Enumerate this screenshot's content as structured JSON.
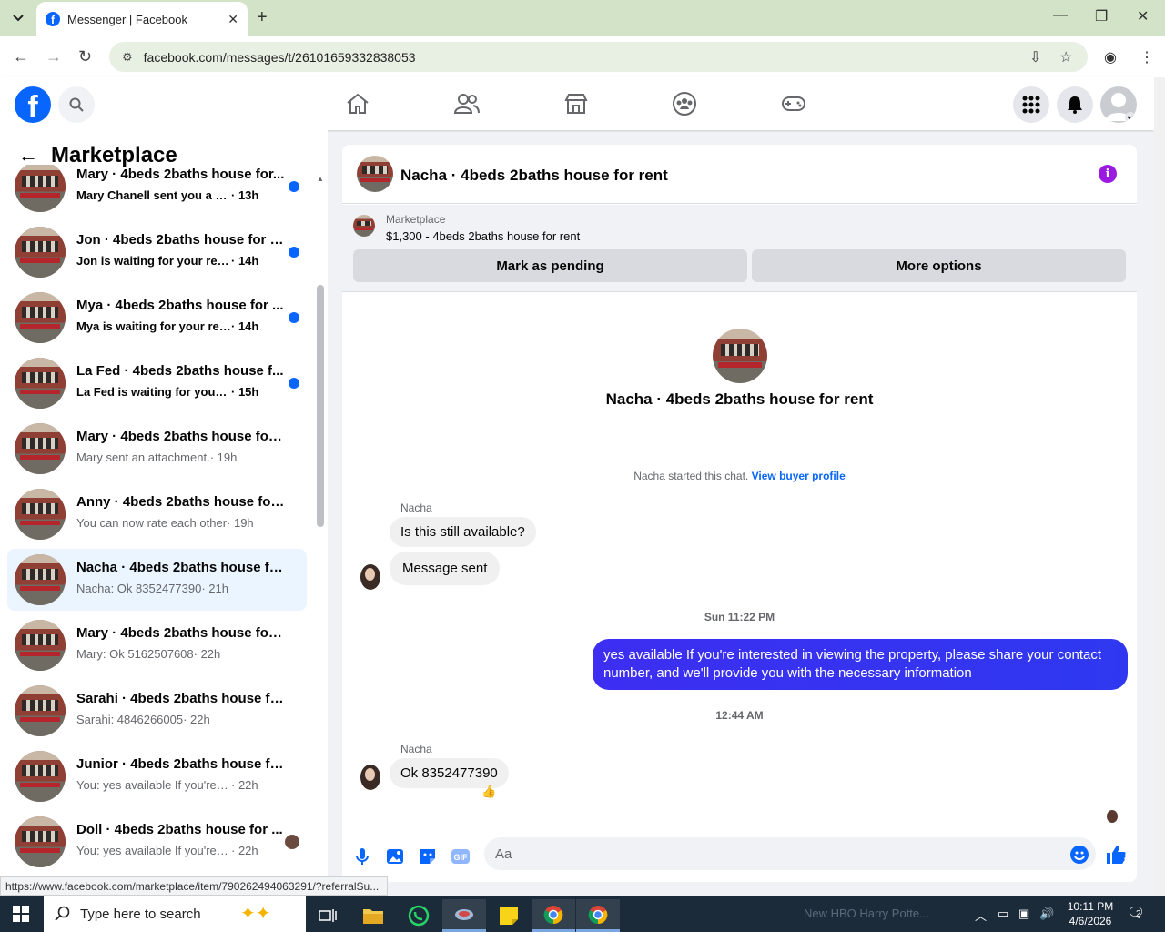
{
  "browser": {
    "tab_title": "Messenger | Facebook",
    "url": "facebook.com/messages/t/26101659332838053",
    "status_url": "https://www.facebook.com/marketplace/item/790262494063291/?referralSu..."
  },
  "sidebar": {
    "title": "Marketplace",
    "conversations": [
      {
        "title": "Mary · 4beds 2baths house for...",
        "text": "Mary Chanell sent you a messa...",
        "time": "· 13h",
        "unread": true
      },
      {
        "title": "Jon · 4beds 2baths house for r...",
        "text": "Jon is waiting for your response.",
        "time": "· 14h",
        "unread": true
      },
      {
        "title": "Mya · 4beds 2baths house for ...",
        "text": "Mya is waiting for your respon...",
        "time": "· 14h",
        "unread": true
      },
      {
        "title": "La Fed · 4beds 2baths house f...",
        "text": "La Fed is waiting for your resp...",
        "time": "· 15h",
        "unread": true
      },
      {
        "title": "Mary · 4beds 2baths house for r...",
        "text": "Mary sent an attachment.",
        "time": "· 19h",
        "unread": false
      },
      {
        "title": "Anny · 4beds 2baths house for r...",
        "text": "You can now rate each other",
        "time": "· 19h",
        "unread": false
      },
      {
        "title": "Nacha · 4beds 2baths house for ...",
        "text": "Nacha: Ok 8352477390",
        "time": "· 21h",
        "unread": false
      },
      {
        "title": "Mary · 4beds 2baths house for r...",
        "text": "Mary: Ok 5162507608",
        "time": "· 22h",
        "unread": false
      },
      {
        "title": "Sarahi · 4beds 2baths house for ...",
        "text": "Sarahi: 4846266005",
        "time": "· 22h",
        "unread": false
      },
      {
        "title": "Junior · 4beds 2baths house for ...",
        "text": "You: yes available If you're interest...",
        "time": "· 22h",
        "unread": false
      },
      {
        "title": "Doll · 4beds 2baths house for ...",
        "text": "You: yes available If you're inter...",
        "time": "· 22h",
        "unread": false
      }
    ]
  },
  "chat": {
    "title": "Nacha · 4beds 2baths house for rent",
    "listing_label": "Marketplace",
    "listing_price": "$1,300 - 4beds 2baths house for rent",
    "mark_pending": "Mark as pending",
    "more_options": "More options",
    "center_name": "Nacha · 4beds 2baths house for rent",
    "started_text": "Nacha started this chat.",
    "view_buyer": "View buyer profile",
    "sender1": "Nacha",
    "msg1": "Is this still available?",
    "msg2": "Message sent",
    "time1": "Sun 11:22 PM",
    "out_msg": "yes available  If you're interested in viewing the property, please share your contact number, and we'll provide you with the necessary information",
    "time2": "12:44 AM",
    "sender2": "Nacha",
    "msg3": "Ok 8352477390",
    "reaction": "👍",
    "composer_placeholder": "Aa"
  },
  "taskbar": {
    "search_placeholder": "Type here to search",
    "notification": "New HBO Harry Potte...",
    "time": "10:11 PM",
    "date": "4/6/2026",
    "badge": "2"
  },
  "colors": {
    "fb_blue": "#0866ff",
    "outgoing_bubble": "#3a2ff1",
    "browser_chrome": "#d3e3c7"
  }
}
